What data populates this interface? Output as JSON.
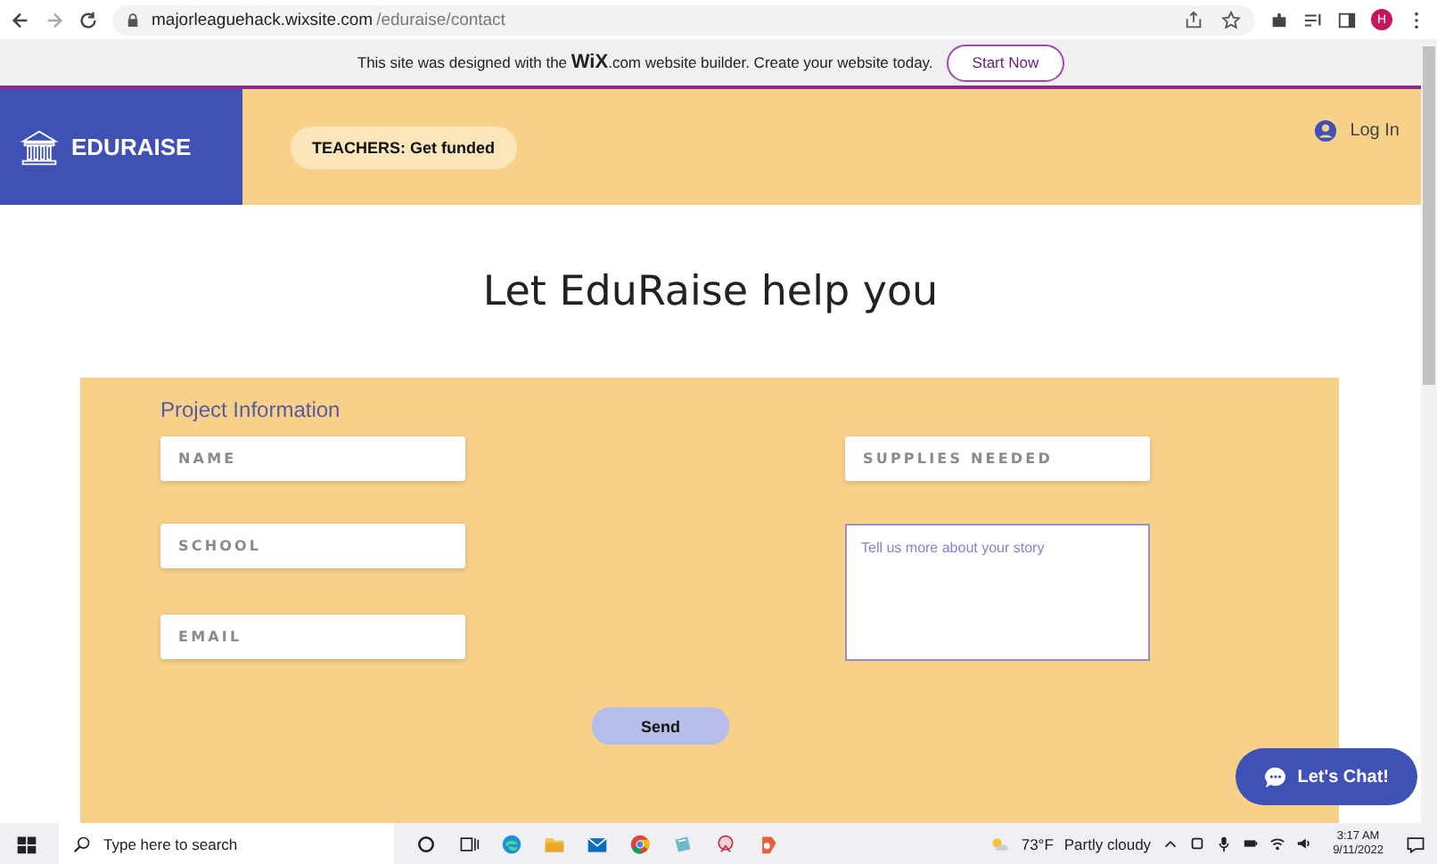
{
  "browser": {
    "url_host": "majorleaguehack.wixsite.com",
    "url_path": "/eduraise/contact",
    "profile": "H"
  },
  "wix_banner": {
    "text_before": "This site was designed with the",
    "brand": "WiX",
    "text_after": ".com website builder. Create your website today.",
    "button": "Start Now"
  },
  "header": {
    "logo": "EDURAISE",
    "pill": "TEACHERS: Get funded",
    "login": "Log In"
  },
  "heading": "Let EduRaise help you",
  "form": {
    "title": "Project Information",
    "left_fields": [
      {
        "placeholder": "NAME"
      },
      {
        "placeholder": "SCHOOL"
      },
      {
        "placeholder": "EMAIL"
      }
    ],
    "supplies": {
      "placeholder": "SUPPLIES NEEDED"
    },
    "story": {
      "placeholder": "Tell us more about your story"
    },
    "send": "Send"
  },
  "chat": {
    "label": "Let's Chat!"
  },
  "taskbar": {
    "search_placeholder": "Type here to search",
    "weather": "73°F",
    "weather_text": "Partly cloudy",
    "time": "3:17 AM",
    "date": "9/11/2022"
  }
}
